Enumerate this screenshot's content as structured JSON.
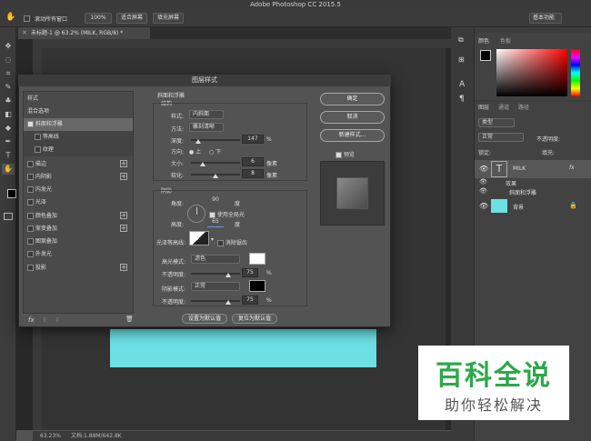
{
  "app": {
    "title": "Adobe Photoshop CC 2015.5"
  },
  "options": {
    "scroll_all": "滚动所有窗口",
    "zoom100": "100%",
    "fit_screen": "适合屏幕",
    "fill_screen": "填充屏幕",
    "workspace": "基本功能"
  },
  "document": {
    "tab": "未标题-1 @ 63.2% (MILK, RGB/8) *"
  },
  "status": {
    "zoom": "63.23%",
    "doc": "文档:1.88M/642.8K"
  },
  "color_panel": {
    "tab1": "颜色",
    "tab2": "色板"
  },
  "layers_panel": {
    "tab1": "图层",
    "tab2": "通道",
    "tab3": "路径",
    "kind": "类型",
    "blend": "正常",
    "opacity_label": "不透明度:",
    "lock_label": "锁定:",
    "fill_label": "填充:",
    "layers": [
      {
        "name": "MILK",
        "fx": "fx"
      },
      {
        "name": "效果"
      },
      {
        "name": "斜面和浮雕"
      },
      {
        "name": "背景",
        "color": "#6ce0e4"
      }
    ]
  },
  "dialog": {
    "title": "图层样式",
    "styles_header": "样式",
    "blend_options": "混合选项",
    "items": [
      {
        "label": "斜面和浮雕",
        "checked": true
      },
      {
        "label": "等高线",
        "checked": false
      },
      {
        "label": "纹理",
        "checked": false
      },
      {
        "label": "描边",
        "plus": "+"
      },
      {
        "label": "内阴影",
        "plus": "+"
      },
      {
        "label": "内发光"
      },
      {
        "label": "光泽"
      },
      {
        "label": "颜色叠加",
        "plus": "+"
      },
      {
        "label": "渐变叠加",
        "plus": "+"
      },
      {
        "label": "图案叠加"
      },
      {
        "label": "外发光"
      },
      {
        "label": "投影",
        "plus": "+"
      }
    ],
    "footer_fx": "fx",
    "bevel": {
      "header": "斜面和浮雕",
      "structure": "结构",
      "style_label": "样式:",
      "style_value": "内斜面",
      "method_label": "方法:",
      "method_value": "雕刻清晰",
      "depth_label": "深度:",
      "depth_value": "147",
      "depth_unit": "%",
      "depth_pct": 0.147,
      "direction_label": "方向:",
      "dir_up": "上",
      "dir_down": "下",
      "size_label": "大小:",
      "size_value": "6",
      "size_unit": "像素",
      "size_pct": 0.24,
      "soften_label": "软化:",
      "soften_value": "8",
      "soften_unit": "像素",
      "soften_pct": 0.5
    },
    "shading": {
      "header": "阴影",
      "angle_label": "角度:",
      "angle_value": "90",
      "angle_unit": "度",
      "global_light": "使用全局光",
      "altitude_label": "高度:",
      "altitude_value": "65",
      "altitude_unit": "度",
      "gloss_label": "光泽等高线:",
      "antialias": "消除锯齿",
      "highlight_label": "高光模式:",
      "highlight_value": "滤色",
      "highlight_opacity": "75",
      "highlight_pct": 0.75,
      "opacity_label": "不透明度:",
      "pct": "%",
      "shadow_label": "阴影模式:",
      "shadow_value": "正常",
      "shadow_opacity": "75",
      "shadow_pct": 0.75
    },
    "make_default": "设置为默认值",
    "reset_default": "复位为默认值",
    "ok": "确定",
    "cancel": "取消",
    "new_style": "新建样式...",
    "preview": "预览"
  },
  "watermark": {
    "line1": "百科全说",
    "line2": "助你轻松解决"
  }
}
